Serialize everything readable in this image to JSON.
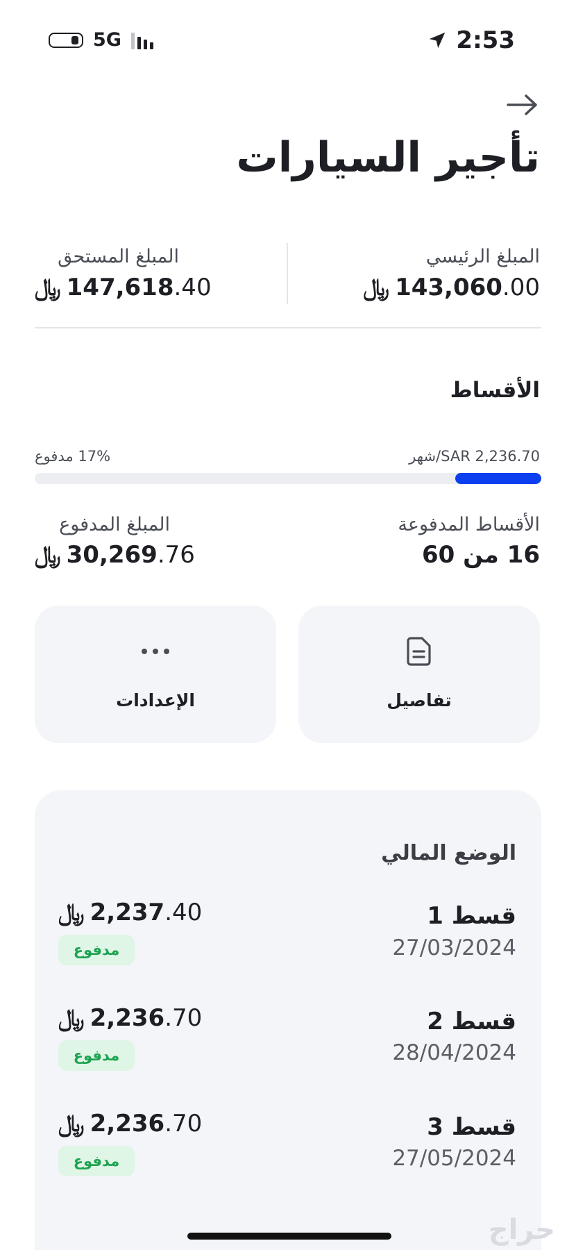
{
  "status_bar": {
    "network": "5G",
    "time": "2:53"
  },
  "header": {
    "title": "تأجير السيارات"
  },
  "summary": {
    "principal": {
      "label": "المبلغ الرئيسي",
      "int": "143,060",
      "dec": ".00",
      "currency": "﷼"
    },
    "due": {
      "label": "المبلغ المستحق",
      "int": "147,618",
      "dec": ".40",
      "currency": "﷼"
    }
  },
  "installments": {
    "title": "الأقساط",
    "monthly_text": "شهر/SAR 2,236.70",
    "paid_percent_text": "17% مدفوع",
    "paid_fraction": 0.17,
    "paid_count": {
      "label": "الأقساط المدفوعة",
      "value": "16 من 60"
    },
    "paid_amount": {
      "label": "المبلغ المدفوع",
      "int": "30,269",
      "dec": ".76",
      "currency": "﷼"
    }
  },
  "actions": {
    "details_label": "تفاصيل",
    "settings_label": "الإعدادات"
  },
  "financial_status": {
    "title": "الوضع المالي",
    "items": [
      {
        "title": "قسط 1",
        "date": "27/03/2024",
        "int": "2,237",
        "dec": ".40",
        "currency": "﷼",
        "status": "مدفوع"
      },
      {
        "title": "قسط 2",
        "date": "28/04/2024",
        "int": "2,236",
        "dec": ".70",
        "currency": "﷼",
        "status": "مدفوع"
      },
      {
        "title": "قسط 3",
        "date": "27/05/2024",
        "int": "2,236",
        "dec": ".70",
        "currency": "﷼",
        "status": "مدفوع"
      }
    ]
  },
  "watermark": "حراج",
  "colors": {
    "accent": "#0b3ff0",
    "paid_badge_bg": "#dff5e6",
    "paid_badge_text": "#1ca350"
  }
}
